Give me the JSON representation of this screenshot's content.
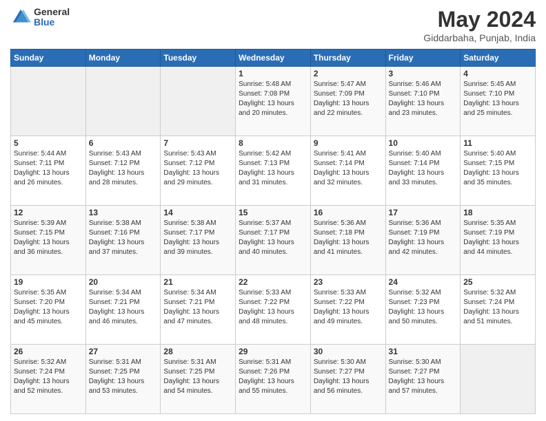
{
  "logo": {
    "general": "General",
    "blue": "Blue"
  },
  "title": "May 2024",
  "subtitle": "Giddarbaha, Punjab, India",
  "days_of_week": [
    "Sunday",
    "Monday",
    "Tuesday",
    "Wednesday",
    "Thursday",
    "Friday",
    "Saturday"
  ],
  "weeks": [
    [
      {
        "day": "",
        "info": ""
      },
      {
        "day": "",
        "info": ""
      },
      {
        "day": "",
        "info": ""
      },
      {
        "day": "1",
        "info": "Sunrise: 5:48 AM\nSunset: 7:08 PM\nDaylight: 13 hours\nand 20 minutes."
      },
      {
        "day": "2",
        "info": "Sunrise: 5:47 AM\nSunset: 7:09 PM\nDaylight: 13 hours\nand 22 minutes."
      },
      {
        "day": "3",
        "info": "Sunrise: 5:46 AM\nSunset: 7:10 PM\nDaylight: 13 hours\nand 23 minutes."
      },
      {
        "day": "4",
        "info": "Sunrise: 5:45 AM\nSunset: 7:10 PM\nDaylight: 13 hours\nand 25 minutes."
      }
    ],
    [
      {
        "day": "5",
        "info": "Sunrise: 5:44 AM\nSunset: 7:11 PM\nDaylight: 13 hours\nand 26 minutes."
      },
      {
        "day": "6",
        "info": "Sunrise: 5:43 AM\nSunset: 7:12 PM\nDaylight: 13 hours\nand 28 minutes."
      },
      {
        "day": "7",
        "info": "Sunrise: 5:43 AM\nSunset: 7:12 PM\nDaylight: 13 hours\nand 29 minutes."
      },
      {
        "day": "8",
        "info": "Sunrise: 5:42 AM\nSunset: 7:13 PM\nDaylight: 13 hours\nand 31 minutes."
      },
      {
        "day": "9",
        "info": "Sunrise: 5:41 AM\nSunset: 7:14 PM\nDaylight: 13 hours\nand 32 minutes."
      },
      {
        "day": "10",
        "info": "Sunrise: 5:40 AM\nSunset: 7:14 PM\nDaylight: 13 hours\nand 33 minutes."
      },
      {
        "day": "11",
        "info": "Sunrise: 5:40 AM\nSunset: 7:15 PM\nDaylight: 13 hours\nand 35 minutes."
      }
    ],
    [
      {
        "day": "12",
        "info": "Sunrise: 5:39 AM\nSunset: 7:15 PM\nDaylight: 13 hours\nand 36 minutes."
      },
      {
        "day": "13",
        "info": "Sunrise: 5:38 AM\nSunset: 7:16 PM\nDaylight: 13 hours\nand 37 minutes."
      },
      {
        "day": "14",
        "info": "Sunrise: 5:38 AM\nSunset: 7:17 PM\nDaylight: 13 hours\nand 39 minutes."
      },
      {
        "day": "15",
        "info": "Sunrise: 5:37 AM\nSunset: 7:17 PM\nDaylight: 13 hours\nand 40 minutes."
      },
      {
        "day": "16",
        "info": "Sunrise: 5:36 AM\nSunset: 7:18 PM\nDaylight: 13 hours\nand 41 minutes."
      },
      {
        "day": "17",
        "info": "Sunrise: 5:36 AM\nSunset: 7:19 PM\nDaylight: 13 hours\nand 42 minutes."
      },
      {
        "day": "18",
        "info": "Sunrise: 5:35 AM\nSunset: 7:19 PM\nDaylight: 13 hours\nand 44 minutes."
      }
    ],
    [
      {
        "day": "19",
        "info": "Sunrise: 5:35 AM\nSunset: 7:20 PM\nDaylight: 13 hours\nand 45 minutes."
      },
      {
        "day": "20",
        "info": "Sunrise: 5:34 AM\nSunset: 7:21 PM\nDaylight: 13 hours\nand 46 minutes."
      },
      {
        "day": "21",
        "info": "Sunrise: 5:34 AM\nSunset: 7:21 PM\nDaylight: 13 hours\nand 47 minutes."
      },
      {
        "day": "22",
        "info": "Sunrise: 5:33 AM\nSunset: 7:22 PM\nDaylight: 13 hours\nand 48 minutes."
      },
      {
        "day": "23",
        "info": "Sunrise: 5:33 AM\nSunset: 7:22 PM\nDaylight: 13 hours\nand 49 minutes."
      },
      {
        "day": "24",
        "info": "Sunrise: 5:32 AM\nSunset: 7:23 PM\nDaylight: 13 hours\nand 50 minutes."
      },
      {
        "day": "25",
        "info": "Sunrise: 5:32 AM\nSunset: 7:24 PM\nDaylight: 13 hours\nand 51 minutes."
      }
    ],
    [
      {
        "day": "26",
        "info": "Sunrise: 5:32 AM\nSunset: 7:24 PM\nDaylight: 13 hours\nand 52 minutes."
      },
      {
        "day": "27",
        "info": "Sunrise: 5:31 AM\nSunset: 7:25 PM\nDaylight: 13 hours\nand 53 minutes."
      },
      {
        "day": "28",
        "info": "Sunrise: 5:31 AM\nSunset: 7:25 PM\nDaylight: 13 hours\nand 54 minutes."
      },
      {
        "day": "29",
        "info": "Sunrise: 5:31 AM\nSunset: 7:26 PM\nDaylight: 13 hours\nand 55 minutes."
      },
      {
        "day": "30",
        "info": "Sunrise: 5:30 AM\nSunset: 7:27 PM\nDaylight: 13 hours\nand 56 minutes."
      },
      {
        "day": "31",
        "info": "Sunrise: 5:30 AM\nSunset: 7:27 PM\nDaylight: 13 hours\nand 57 minutes."
      },
      {
        "day": "",
        "info": ""
      }
    ]
  ]
}
